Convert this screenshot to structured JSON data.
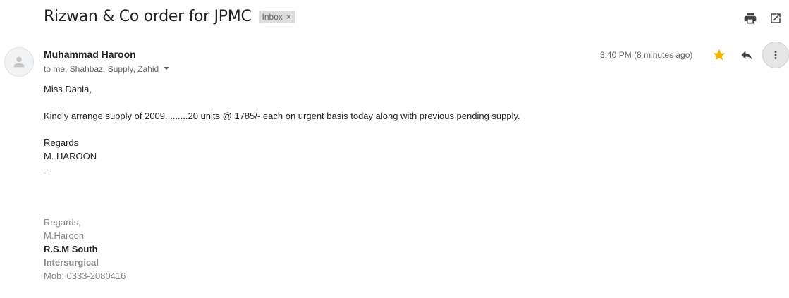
{
  "email": {
    "subject": "Rizwan & Co order for JPMC",
    "label": "Inbox",
    "label_remove": "×",
    "sender": "Muhammad Haroon",
    "recipients": "to me, Shahbaz, Supply, Zahid",
    "time": "3:40 PM (8 minutes ago)",
    "body": {
      "greeting": "Miss Dania,",
      "message": "Kindly arrange supply of 2009.........20 units @ 1785/- each on urgent basis today along with previous pending supply.",
      "closing": "Regards",
      "name": "M. HAROON",
      "separator": "--"
    },
    "signature": {
      "regards": "Regards,",
      "name": "M.Haroon",
      "title": "R.S.M South",
      "company": "Intersurgical",
      "mobile": "Mob: 0333-2080416"
    }
  },
  "icons": [
    "print-icon",
    "open-in-new-window-icon",
    "avatar-person-icon",
    "chevron-down-icon",
    "star-icon",
    "reply-icon",
    "more-vert-icon"
  ],
  "colors": {
    "star": "#f4b400",
    "label_bg": "#dddddd",
    "more_bg": "#e6e6e6"
  }
}
